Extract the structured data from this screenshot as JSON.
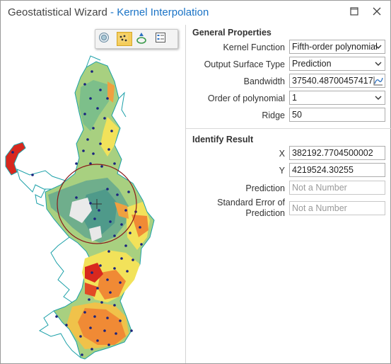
{
  "window": {
    "title": "Geostatistical Wizard",
    "subtitle": "- Kernel Interpolation",
    "maximize_icon": "maximize-icon",
    "close_icon": "close-icon"
  },
  "map": {
    "toolbar": [
      {
        "name": "globe-icon"
      },
      {
        "name": "points-layer-icon"
      },
      {
        "name": "surface-icon"
      },
      {
        "name": "legend-icon"
      }
    ],
    "colors": {
      "low": "#2e8b8f",
      "mid": "#a8d080",
      "midhigh": "#f2e25a",
      "high": "#f08a35",
      "max": "#d8281e",
      "points": "#1a237e",
      "outline": "#1ba0a8",
      "circle": "#8b1a1a"
    }
  },
  "general": {
    "title": "General Properties",
    "rows": [
      {
        "label": "Kernel Function",
        "value": "Fifth-order polynomial",
        "type": "select"
      },
      {
        "label": "Output Surface Type",
        "value": "Prediction",
        "type": "select"
      },
      {
        "label": "Bandwidth",
        "value": "37540.48700457417",
        "type": "bandwidth"
      },
      {
        "label": "Order of polynomial",
        "value": "1",
        "type": "select"
      },
      {
        "label": "Ridge",
        "value": "50",
        "type": "text"
      }
    ]
  },
  "identify": {
    "title": "Identify Result",
    "x_label": "X",
    "x_value": "382192.7704500002",
    "y_label": "Y",
    "y_value": "4219524.30255",
    "prediction_label": "Prediction",
    "prediction_value": "Not a Number",
    "stderr_label": "Standard Error of Prediction",
    "stderr_value": "Not a Number"
  }
}
